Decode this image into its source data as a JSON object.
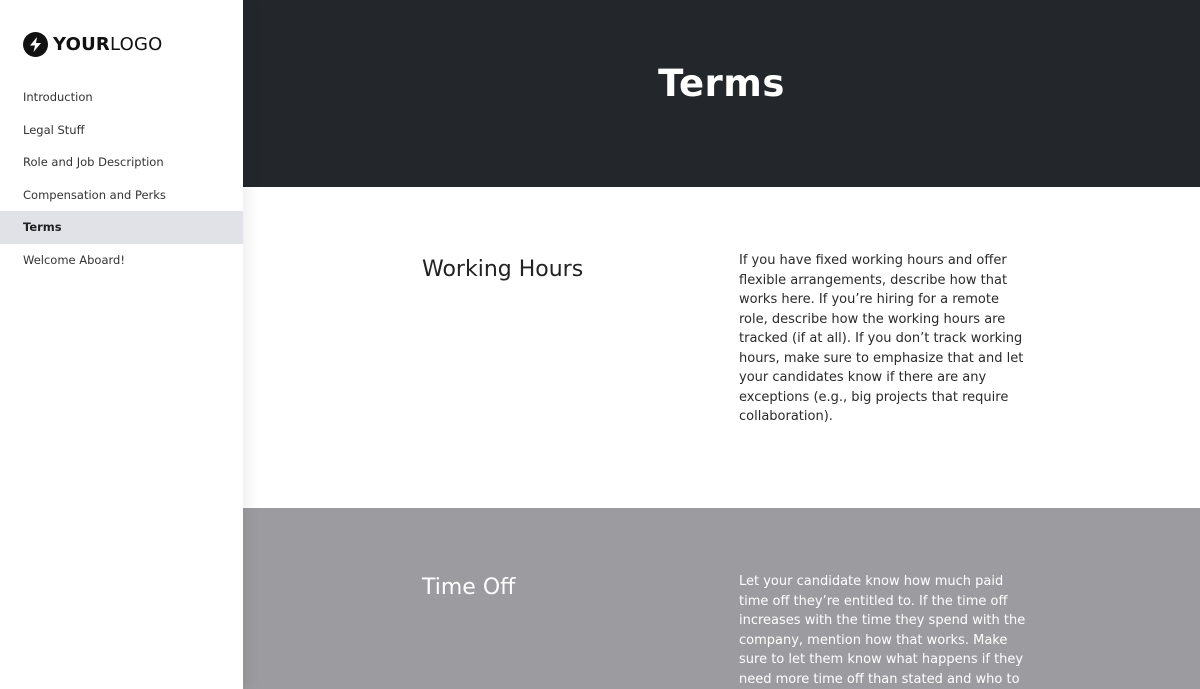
{
  "logo": {
    "icon": "lightning-bolt-icon",
    "text_bold": "YOUR",
    "text_light": "LOGO"
  },
  "sidebar": {
    "items": [
      {
        "label": "Introduction",
        "active": false
      },
      {
        "label": "Legal Stuff",
        "active": false
      },
      {
        "label": "Role and Job Description",
        "active": false
      },
      {
        "label": "Compensation and Perks",
        "active": false
      },
      {
        "label": "Terms",
        "active": true
      },
      {
        "label": "Welcome Aboard!",
        "active": false
      }
    ]
  },
  "header": {
    "title": "Terms"
  },
  "sections": [
    {
      "title": "Working Hours",
      "body": "If you have fixed working hours and offer flexible arrangements, describe how that works here. If you’re hiring for a remote role, describe how the working hours are tracked (if at all). If you don’t track working hours, make sure to emphasize that and let your candidates know if there are any exceptions (e.g., big projects that require collaboration)."
    },
    {
      "title": "Time Off",
      "body": "Let your candidate know how much paid time off they’re entitled to. If the time off increases with the time they spend with the company, mention how that works. Make sure to let them know what happens if they need more time off than stated and who to"
    }
  ],
  "colors": {
    "header_bg": "#23272c",
    "active_nav_bg": "#e0e2e8",
    "gray_section_bg": "#9c9b9f"
  }
}
